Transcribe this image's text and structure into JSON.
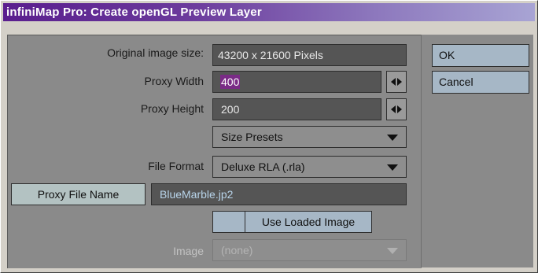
{
  "window": {
    "title": "infiniMap Pro: Create openGL Preview Layer"
  },
  "form": {
    "original_size_label": "Original image size:",
    "original_size_value": "43200 x 21600 Pixels",
    "proxy_width_label": "Proxy Width",
    "proxy_width_value": "400",
    "proxy_height_label": "Proxy Height",
    "proxy_height_value": "200",
    "size_presets_value": "Size Presets",
    "file_format_label": "File Format",
    "file_format_value": "Deluxe RLA (.rla)",
    "proxy_file_button": "Proxy File Name",
    "proxy_file_value": "BlueMarble.jp2",
    "use_loaded_label": "Use Loaded Image",
    "image_label": "Image",
    "image_value": "(none)"
  },
  "actions": {
    "ok_label": "OK",
    "cancel_label": "Cancel"
  }
}
